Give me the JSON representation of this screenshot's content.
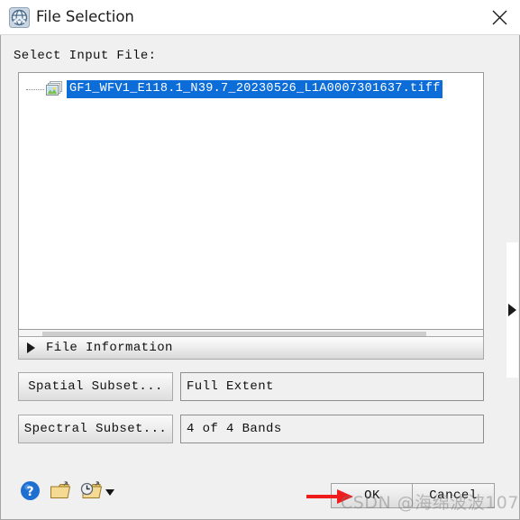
{
  "window": {
    "title": "File Selection",
    "app_icon": "envi-globe-icon",
    "close_label": "✕"
  },
  "main": {
    "select_label": "Select Input File:",
    "tree": {
      "items": [
        {
          "label": "GF1_WFV1_E118.1_N39.7_20230526_L1A0007301637.tiff",
          "icon": "stacked-images-icon",
          "selected": true
        }
      ]
    },
    "scrollbar": {
      "left_arrow": "‹",
      "right_arrow": "›"
    },
    "right_splitter_icon": "expand-right-triangle-icon",
    "file_information": {
      "label": "File Information",
      "expanded": false,
      "triangle_icon": "triangle-right-icon"
    },
    "rows": [
      {
        "button_label": "Spatial Subset...",
        "value": "Full Extent"
      },
      {
        "button_label": "Spectral Subset...",
        "value": "4 of 4 Bands"
      }
    ]
  },
  "toolbar": {
    "help_icon": "help-question-icon",
    "open_folder_icon": "open-file-folder-icon",
    "recent_files_icon": "recent-files-clock-folder-icon",
    "dropdown_icon": "chevron-down-icon"
  },
  "actions": {
    "ok_label": "OK",
    "cancel_label": "Cancel"
  },
  "annotations": {
    "arrow_color": "#ee1c1c",
    "watermark": "CSDN @海绵波波107"
  },
  "colors": {
    "selection_blue": "#0d6dd8",
    "dialog_bg": "#f0f0f0",
    "titlebar_bg": "#ffffff",
    "field_bg": "#f0f0f0",
    "border": "#9a9a9a"
  }
}
